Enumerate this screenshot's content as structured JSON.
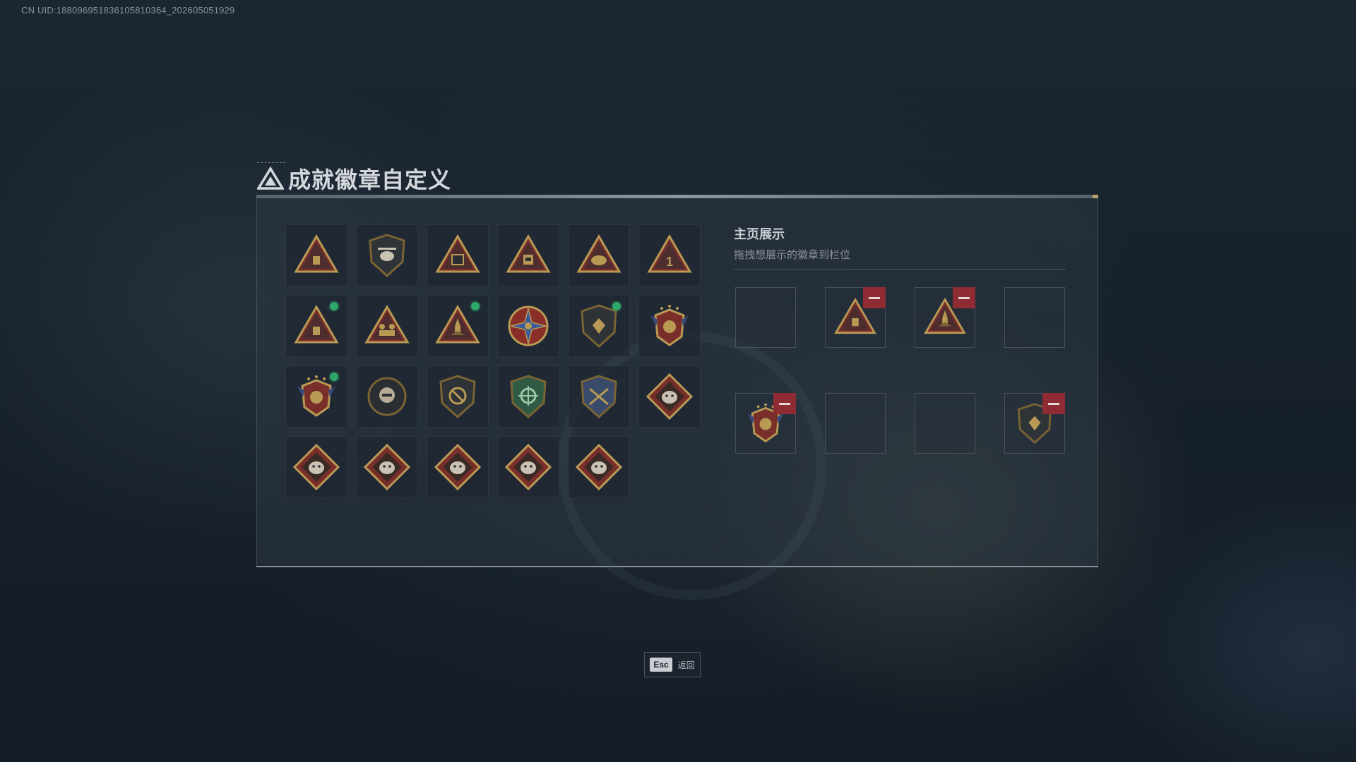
{
  "uid_text": "CN UID:188096951836105810364_202605051929",
  "title": "成就徽章自定义",
  "showcase": {
    "title": "主页展示",
    "subtitle": "拖拽想展示的徽章到栏位"
  },
  "footer": {
    "key": "Esc",
    "label": "返回"
  },
  "colors": {
    "accent_gold": "#b89a55",
    "new_dot": "#2fa76a",
    "remove": "#8e2b33"
  },
  "badges": [
    {
      "name": "shield-triangle-badge",
      "new": false
    },
    {
      "name": "helicopter-shield-badge",
      "new": false
    },
    {
      "name": "tablet-triangle-badge",
      "new": false
    },
    {
      "name": "pack-triangle-badge",
      "new": false
    },
    {
      "name": "helmet-triangle-badge",
      "new": false
    },
    {
      "name": "number-one-triangle-badge",
      "new": false
    },
    {
      "name": "backpack-triangle-badge",
      "new": true
    },
    {
      "name": "soldiers-triangle-badge",
      "new": false
    },
    {
      "name": "rocket-triangle-badge",
      "new": true
    },
    {
      "name": "star-compass-badge",
      "new": false
    },
    {
      "name": "eagle-shield-badge",
      "new": true
    },
    {
      "name": "stars-crest-badge",
      "new": false
    },
    {
      "name": "winged-crest-badge",
      "new": true
    },
    {
      "name": "skull-round-badge",
      "new": false
    },
    {
      "name": "no-weapon-shield-badge",
      "new": false
    },
    {
      "name": "crosshair-green-shield-badge",
      "new": false
    },
    {
      "name": "crossed-rifles-shield-badge",
      "new": false
    },
    {
      "name": "wolf-diamond-badge",
      "new": false
    },
    {
      "name": "wolf-diamond-badge-2",
      "new": false
    },
    {
      "name": "dragon-diamond-badge",
      "new": false
    },
    {
      "name": "dragon-diamond-badge-2",
      "new": false
    },
    {
      "name": "runner-diamond-badge",
      "new": false
    },
    {
      "name": "croc-diamond-badge",
      "new": false
    }
  ],
  "slots": [
    {
      "filled": false,
      "badge": ""
    },
    {
      "filled": true,
      "badge": "backpack-triangle-badge"
    },
    {
      "filled": true,
      "badge": "rocket-triangle-badge"
    },
    {
      "filled": false,
      "badge": ""
    },
    {
      "filled": true,
      "badge": "winged-crest-badge"
    },
    {
      "filled": false,
      "badge": ""
    },
    {
      "filled": false,
      "badge": ""
    },
    {
      "filled": true,
      "badge": "eagle-shield-badge"
    }
  ]
}
